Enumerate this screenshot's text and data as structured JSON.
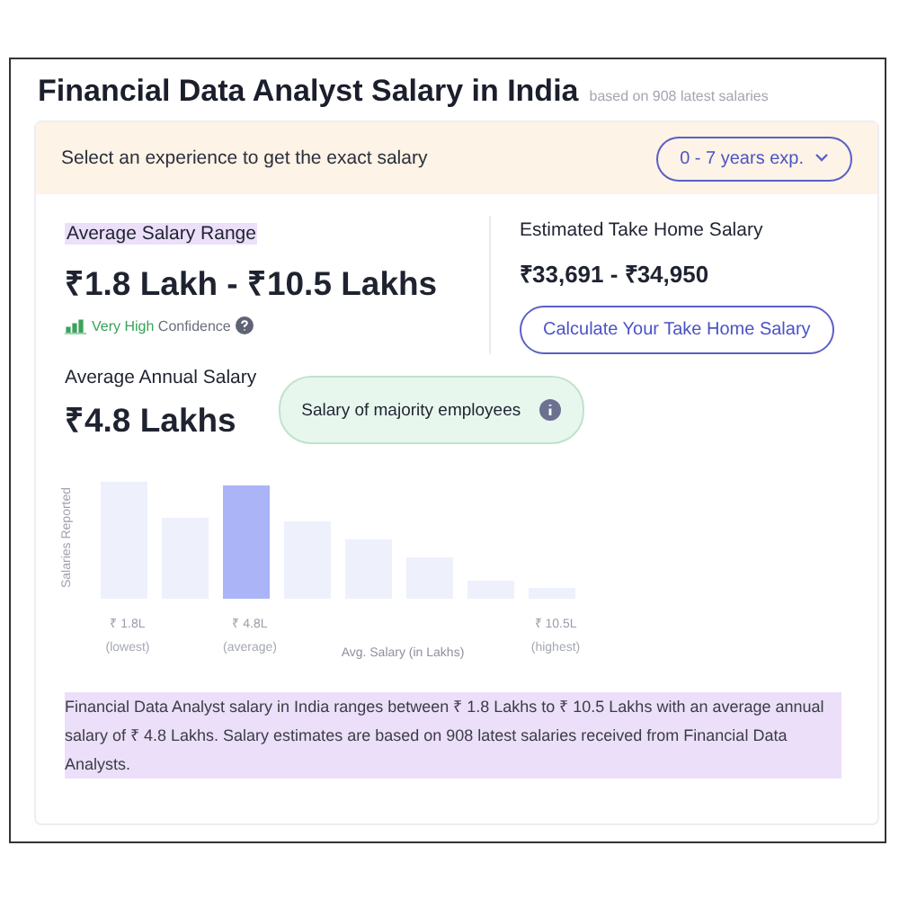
{
  "title": "Financial Data Analyst Salary in India",
  "subtitle": "based on 908 latest salaries",
  "experience_bar": {
    "prompt": "Select an experience to get the exact salary",
    "dropdown": "0 - 7 years exp."
  },
  "salary_range": {
    "label": "Average Salary Range",
    "value": "₹1.8 Lakh - ₹10.5 Lakhs",
    "confidence_level": "Very High",
    "confidence_label": "Confidence"
  },
  "take_home": {
    "label": "Estimated Take Home Salary",
    "value": "₹33,691 - ₹34,950",
    "button": "Calculate Your Take Home Salary"
  },
  "average": {
    "label": "Average Annual Salary",
    "value": "₹4.8 Lakhs",
    "tooltip": "Salary of majority employees"
  },
  "chart": {
    "ylabel": "Salaries Reported",
    "xlabel": "Avg. Salary (in Lakhs)",
    "x_labels": [
      {
        "value": "₹ 1.8L",
        "note": "(lowest)"
      },
      {
        "value": "₹ 4.8L",
        "note": "(average)"
      },
      {
        "value": "₹ 10.5L",
        "note": "(highest)"
      }
    ]
  },
  "summary": "Financial Data Analyst salary in India ranges between ₹ 1.8 Lakhs to ₹ 10.5 Lakhs with an average annual salary of ₹ 4.8 Lakhs. Salary estimates are based on 908 latest salaries received from Financial Data Analysts."
}
